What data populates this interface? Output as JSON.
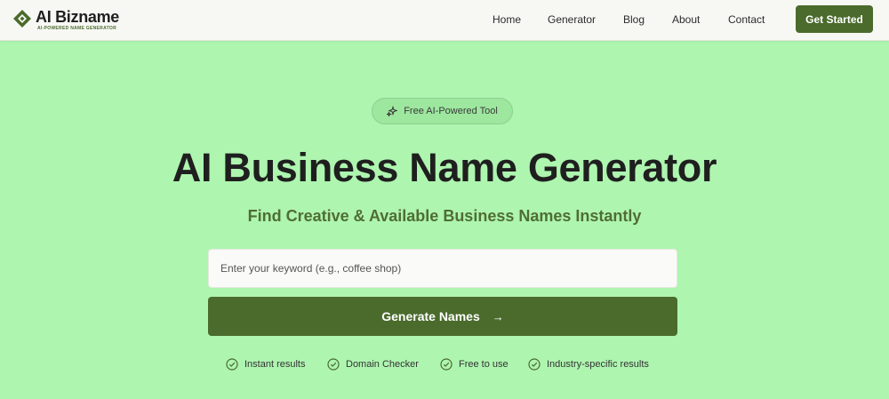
{
  "brand": {
    "name": "AI Bizname",
    "tagline": "AI-POWERED NAME GENERATOR",
    "color": "#4a6b2c"
  },
  "nav": {
    "items": [
      {
        "label": "Home"
      },
      {
        "label": "Generator"
      },
      {
        "label": "Blog"
      },
      {
        "label": "About"
      },
      {
        "label": "Contact"
      }
    ],
    "cta_label": "Get Started"
  },
  "hero": {
    "badge": {
      "icon": "sparkles-icon",
      "label": "Free AI-Powered Tool"
    },
    "title": "AI Business Name Generator",
    "subtitle": "Find Creative & Available Business Names Instantly",
    "search": {
      "placeholder": "Enter your keyword (e.g., coffee shop)",
      "value": ""
    },
    "generate_label": "Generate Names",
    "generate_icon": "arrow-right-icon",
    "features": [
      {
        "icon": "check-circle-icon",
        "label": "Instant results"
      },
      {
        "icon": "check-circle-icon",
        "label": "Domain Checker"
      },
      {
        "icon": "check-circle-icon",
        "label": "Free to use"
      },
      {
        "icon": "check-circle-icon",
        "label": "Industry-specific results"
      }
    ]
  },
  "colors": {
    "background": "#aef5b0",
    "header_bg": "#f7f8f4",
    "primary": "#4a6b2c",
    "subtitle": "#4f6e32"
  }
}
